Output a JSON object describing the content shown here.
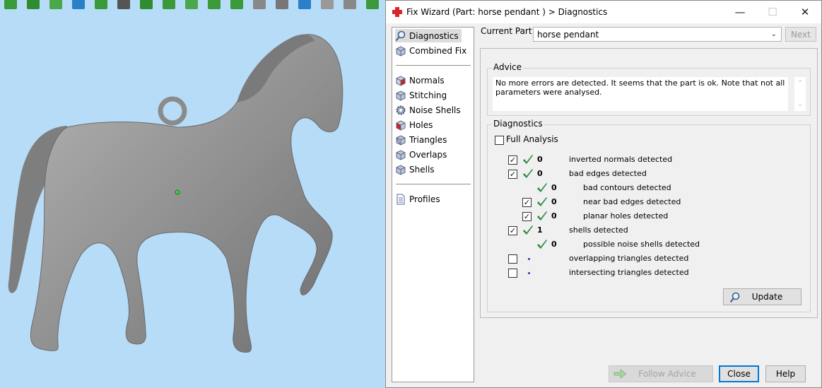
{
  "window": {
    "title": "Fix Wizard (Part: horse pendant ) > Diagnostics",
    "controls": {
      "minimize": "—",
      "maximize": "☐",
      "close": "✕"
    }
  },
  "toolbar": {
    "icons": [
      "select-icon",
      "arrow-icon",
      "leaf-icon",
      "move-icon",
      "leaf-icon",
      "cut-icon",
      "move-icon",
      "leaf-icon",
      "leaf-icon",
      "leaf-icon",
      "leaf-icon",
      "cube-icon",
      "cube-icon",
      "cube-icon",
      "cube-icon",
      "cube-icon",
      "leaf-icon"
    ]
  },
  "nav": {
    "items": [
      {
        "label": "Diagnostics",
        "icon": "magnifier-icon",
        "selected": true
      },
      {
        "label": "Combined Fix",
        "icon": "cube-icon"
      },
      {
        "label": "Normals",
        "icon": "cube-red-icon"
      },
      {
        "label": "Stitching",
        "icon": "cube-icon"
      },
      {
        "label": "Noise Shells",
        "icon": "gear-cube-icon"
      },
      {
        "label": "Holes",
        "icon": "cube-red-icon"
      },
      {
        "label": "Triangles",
        "icon": "cube-icon"
      },
      {
        "label": "Overlaps",
        "icon": "cube-icon"
      },
      {
        "label": "Shells",
        "icon": "cube-icon"
      },
      {
        "label": "Profiles",
        "icon": "document-icon"
      }
    ]
  },
  "current_part": {
    "label": "Current Part:",
    "value": "horse pendant",
    "next_label": "Next"
  },
  "advice": {
    "legend": "Advice",
    "text": "No more errors are detected. It seems that the part is ok. Note that not all parameters were analysed."
  },
  "diagnostics": {
    "legend": "Diagnostics",
    "full_analysis_label": "Full Analysis",
    "full_analysis_checked": false,
    "rows": [
      {
        "checked": true,
        "status": "ok",
        "count": "0",
        "label": "inverted normals detected",
        "level": 0,
        "has_checkbox": true
      },
      {
        "checked": true,
        "status": "ok",
        "count": "0",
        "label": "bad edges detected",
        "level": 0,
        "has_checkbox": true
      },
      {
        "checked": false,
        "status": "ok",
        "count": "0",
        "label": "bad contours detected",
        "level": 1,
        "has_checkbox": false
      },
      {
        "checked": true,
        "status": "ok",
        "count": "0",
        "label": "near bad edges detected",
        "level": 1,
        "has_checkbox": true
      },
      {
        "checked": true,
        "status": "ok",
        "count": "0",
        "label": "planar holes detected",
        "level": 1,
        "has_checkbox": true
      },
      {
        "checked": true,
        "status": "ok",
        "count": "1",
        "label": "shells detected",
        "level": 0,
        "has_checkbox": true
      },
      {
        "checked": false,
        "status": "ok",
        "count": "0",
        "label": "possible noise shells detected",
        "level": 1,
        "has_checkbox": false
      },
      {
        "checked": false,
        "status": "dot",
        "count": "",
        "label": "overlapping triangles detected",
        "level": 0,
        "has_checkbox": true
      },
      {
        "checked": false,
        "status": "dot",
        "count": "",
        "label": "intersecting triangles detected",
        "level": 0,
        "has_checkbox": true
      }
    ],
    "update_label": "Update"
  },
  "footer": {
    "follow_advice_label": "Follow Advice",
    "close_label": "Close",
    "help_label": "Help"
  },
  "colors": {
    "viewport_bg": "#b7dcf8",
    "model_gray": "#8e8e8e",
    "check_green": "#2b8a3e",
    "accent": "#0078d7"
  }
}
